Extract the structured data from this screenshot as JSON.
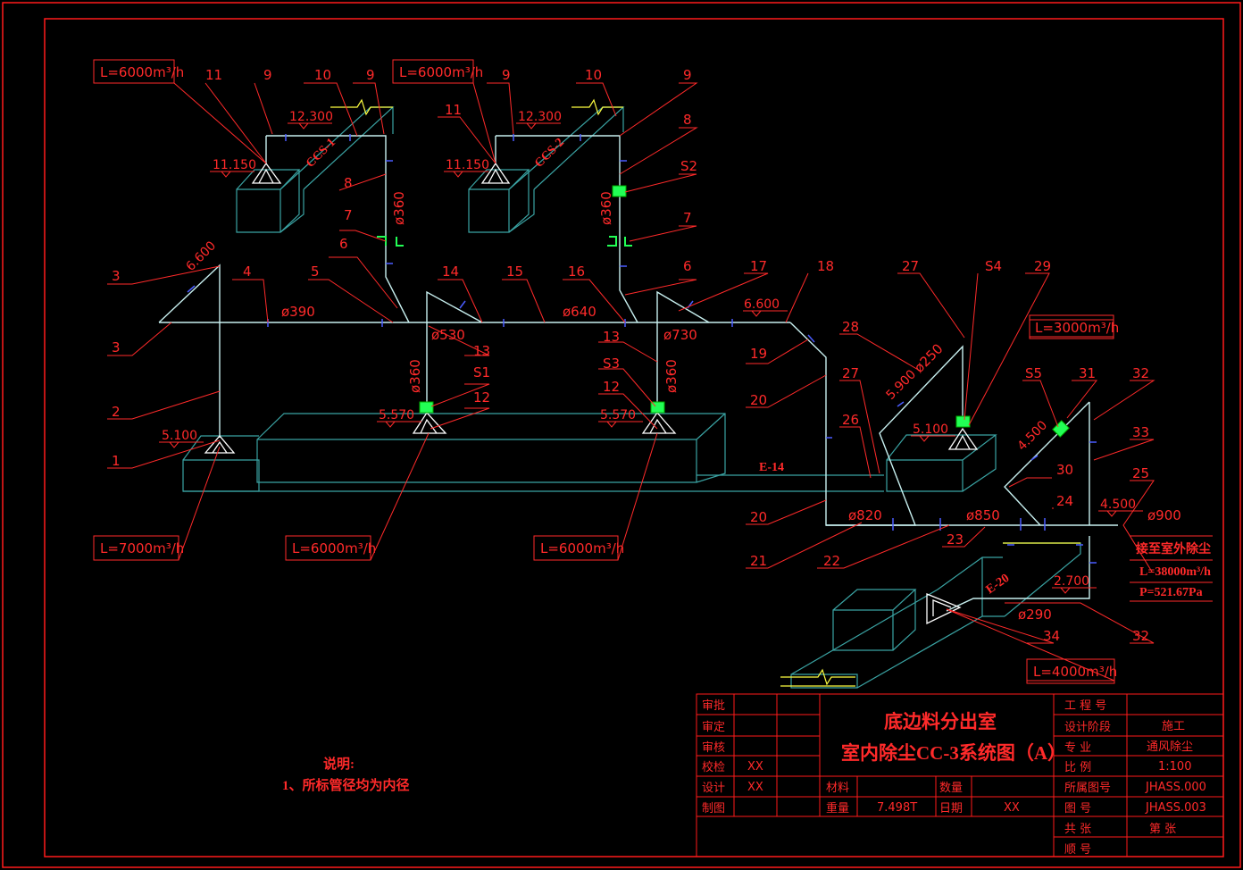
{
  "colors": {
    "frame": "#ff1a1a",
    "pipe": "#c8f0f0",
    "duct": "#3aa3a3",
    "label": "#ff2a2a",
    "accent": "#ffffff",
    "green": "#22ff55",
    "blue": "#4a5cff",
    "yellow": "#ffff40"
  },
  "boxes": {
    "l6000_1": "L=6000m³/h",
    "l6000_2": "L=6000m³/h",
    "l3000": "L=3000m³/h",
    "l7000": "L=7000m³/h",
    "l6000_3": "L=6000m³/h",
    "l6000_4": "L=6000m³/h",
    "l4000": "L=4000m³/h"
  },
  "elevations": {
    "e12300a": "12.300",
    "e11150a": "11.150",
    "e12300b": "12.300",
    "e11150b": "11.150",
    "e6600a": "6.600",
    "e6600b": "6.600",
    "e5100a": "5.100",
    "e5570a": "5.570",
    "e5570b": "5.570",
    "e5900": "5.900",
    "e5100b": "5.100",
    "e4500a": "4.500",
    "e4500b": "4.500",
    "e2700": "2.700"
  },
  "diameters": {
    "d360a": "ø360",
    "d360b": "ø360",
    "d390": "ø390",
    "d530": "ø530",
    "d640": "ø640",
    "d730": "ø730",
    "d360c": "ø360",
    "d360d": "ø360",
    "d250": "ø250",
    "d820": "ø820",
    "d850": "ø850",
    "d900": "ø900",
    "d290": "ø290"
  },
  "equipment": {
    "ccs1": "CCS-1",
    "ccs2": "CCS-2",
    "e14": "E-14",
    "e20": "E-20"
  },
  "leaders": {
    "n11a": "11",
    "n9a": "9",
    "n10a": "10",
    "n9b": "9",
    "n11b": "11",
    "n9c": "9",
    "n10b": "10",
    "n9d": "9",
    "n8a": "8",
    "n8b": "8",
    "s2": "S2",
    "n7a": "7",
    "n7b": "7",
    "n3a": "3",
    "n3b": "3",
    "n4": "4",
    "n5": "5",
    "n6a": "6",
    "n14": "14",
    "n15": "15",
    "n16": "16",
    "n6b": "6",
    "n17": "17",
    "n18": "18",
    "n27a": "27",
    "s4": "S4",
    "n29": "29",
    "n28": "28",
    "n13a": "13",
    "s1": "S1",
    "n12a": "12",
    "n13b": "13",
    "s3": "S3",
    "n12b": "12",
    "n2": "2",
    "n1": "1",
    "n19": "19",
    "n20a": "20",
    "n27b": "27",
    "n26": "26",
    "s5": "S5",
    "n31": "31",
    "n32a": "32",
    "n33": "33",
    "n30": "30",
    "n25": "25",
    "n24": "24",
    "n20b": "20",
    "n21": "21",
    "n22": "22",
    "n23": "23",
    "n34": "34",
    "n32b": "32"
  },
  "outdoor": {
    "title": "接至室外除尘",
    "flow": "L=38000m³/h",
    "pressure": "P=521.67Pa"
  },
  "notes": {
    "title": "说明:",
    "line1": "1、所标管径均为内径"
  },
  "titleblock": {
    "title1": "底边料分出室",
    "title2": "室内除尘CC-3系统图（A）",
    "rows_left": [
      "审批",
      "审定",
      "审核",
      "校检",
      "设计",
      "制图"
    ],
    "checker": "XX",
    "designer": "XX",
    "material_label": "材料",
    "qty_label": "数量",
    "weight_label": "重量",
    "weight": "7.498T",
    "date_label": "日期",
    "date": "XX",
    "right_labels": [
      "工 程 号",
      "设计阶段",
      "专    业",
      "比    例",
      "所属图号",
      "图    号",
      "共    张",
      "顺    号"
    ],
    "stage": "施工",
    "discipline": "通风除尘",
    "scale": "1:100",
    "ref_no": "JHASS.000",
    "drawing_no": "JHASS.003",
    "page": "第    张"
  }
}
